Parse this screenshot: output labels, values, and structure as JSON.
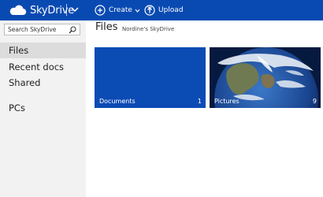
{
  "app": {
    "name": "SkyDrive"
  },
  "toolbar": {
    "create_label": "Create",
    "upload_label": "Upload"
  },
  "sidebar": {
    "search_placeholder": "Search SkyDrive",
    "items": [
      {
        "label": "Files",
        "active": true
      },
      {
        "label": "Recent docs",
        "active": false
      },
      {
        "label": "Shared",
        "active": false
      },
      {
        "label": "PCs",
        "active": false
      }
    ]
  },
  "main": {
    "title": "Files",
    "owner": "Nordine's SkyDrive",
    "tiles": [
      {
        "name": "Documents",
        "count": "1"
      },
      {
        "name": "Pictures",
        "count": "9"
      }
    ]
  },
  "colors": {
    "brand_blue": "#094ab2",
    "tile_blue": "#0b4bb4",
    "sidebar_bg": "#f2f2f2"
  }
}
